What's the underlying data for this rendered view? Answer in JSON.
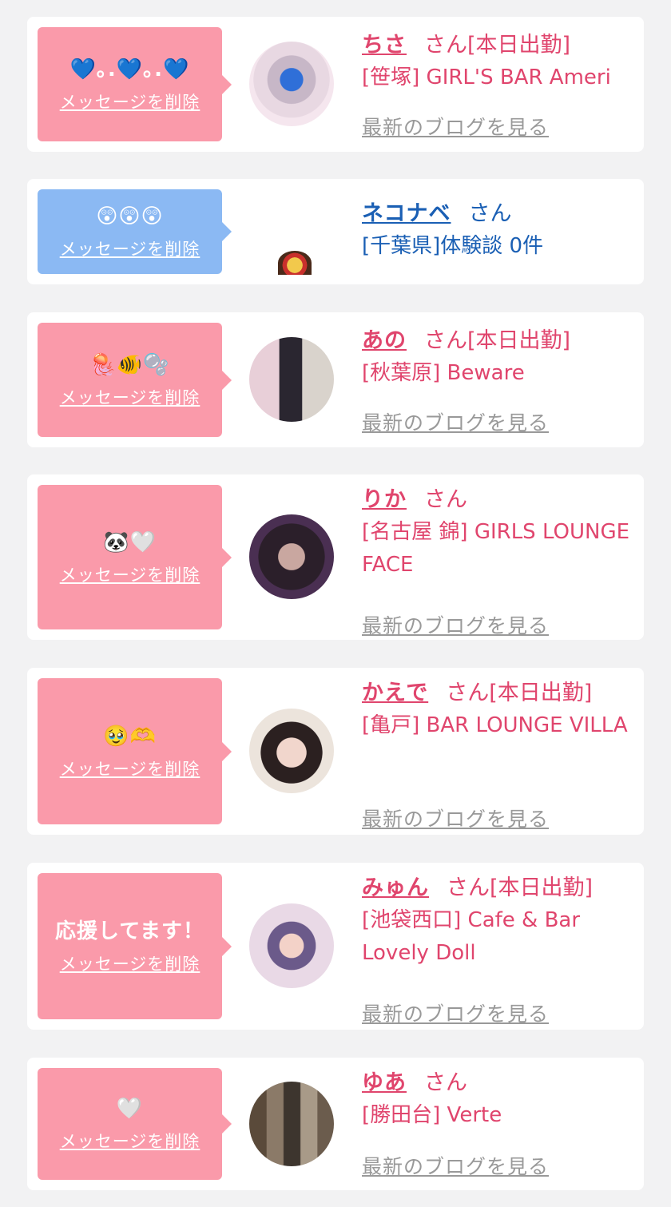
{
  "delete_label": "メッセージを削除",
  "blog_label": "最新のブログを見る",
  "san_label": "さん",
  "colors": {
    "pink_bubble": "#fa9aaa",
    "blue_bubble": "#8bb9f3",
    "pink_text": "#e0456d",
    "blue_text": "#1a5fb4"
  },
  "entries": [
    {
      "message": "💙｡.💙｡.💙",
      "name": "ちさ",
      "status": "[本日出勤]",
      "shop": "[笹塚] GIRL'S BAR Ameri"
    },
    {
      "message": "😲😲😲",
      "name": "ネコナベ",
      "status": "",
      "shop": "[千葉県]体験談 0件"
    },
    {
      "message": "🪼🐠🫧",
      "name": "あの",
      "status": "[本日出勤]",
      "shop": "[秋葉原] Beware"
    },
    {
      "message": "🐼🤍",
      "name": "りか",
      "status": "",
      "shop": "[名古屋 錦] GIRLS LOUNGE FACE"
    },
    {
      "message": "🥹🫶",
      "name": "かえで",
      "status": "[本日出勤]",
      "shop": "[亀戸] BAR LOUNGE VILLA"
    },
    {
      "message": "応援してます！",
      "name": "みゅん",
      "status": "[本日出勤]",
      "shop": "[池袋西口] Cafe & Bar Lovely Doll"
    },
    {
      "message": "🤍",
      "name": "ゆあ",
      "status": "",
      "shop": "[勝田台] Verte"
    }
  ]
}
